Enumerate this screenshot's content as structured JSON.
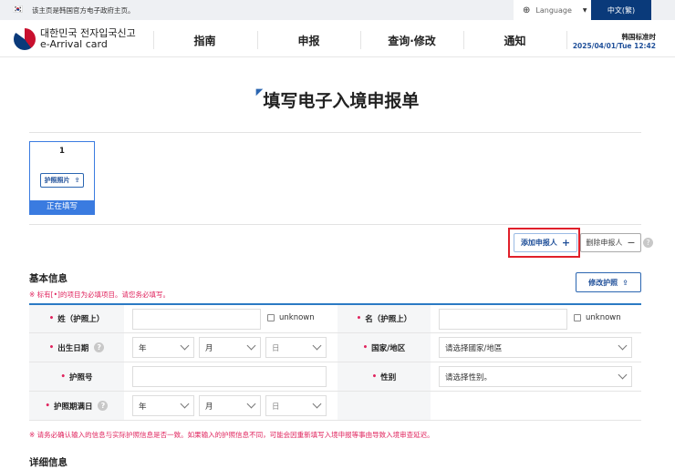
{
  "topbar": {
    "notice": "该主页是韩国官方电子政府主页。",
    "language_label": "Language",
    "current_language": "中文(繁)"
  },
  "header": {
    "logo_korean": "대한민국 전자입국신고",
    "logo_english": "e-Arrival card",
    "nav": [
      "指南",
      "申报",
      "查询·修改",
      "通知"
    ],
    "timezone_label": "韩国标准时",
    "datetime": "2025/04/01/Tue 12:42"
  },
  "page": {
    "title": "填写电子入境申报单"
  },
  "applicant_card": {
    "number": "1",
    "passport_photo_label": "护照照片",
    "status": "正在填写"
  },
  "actions": {
    "add_applicant": "添加申报人",
    "delete_applicant": "删除申报人"
  },
  "basic_info": {
    "heading": "基本信息",
    "required_note": "※ 标有[•]的项目为必填项目。请您务必填写。",
    "edit_passport": "修改护照",
    "fields": {
      "surname": "姓（护照上）",
      "given_name": "名（护照上）",
      "birth_date": "出生日期",
      "country": "国家/地区",
      "passport_no": "护照号",
      "gender": "性别",
      "expiry_date": "护照期满日"
    },
    "unknown_label": "unknown",
    "year": "年",
    "month": "月",
    "day": "日",
    "country_placeholder": "请选择國家/地區",
    "gender_placeholder": "请选择性别。",
    "warning": "※ 请务必确认输入的信息与实际护照信息是否一致。如果输入的护照信息不同，可能会因重新填写入境申报等事由导致入境审查延迟。"
  },
  "detail_info": {
    "heading": "详细信息"
  },
  "colors": {
    "navy": "#0a3a7a",
    "blue": "#2b66b1",
    "red": "#e0245e",
    "highlight": "#e0202a"
  }
}
